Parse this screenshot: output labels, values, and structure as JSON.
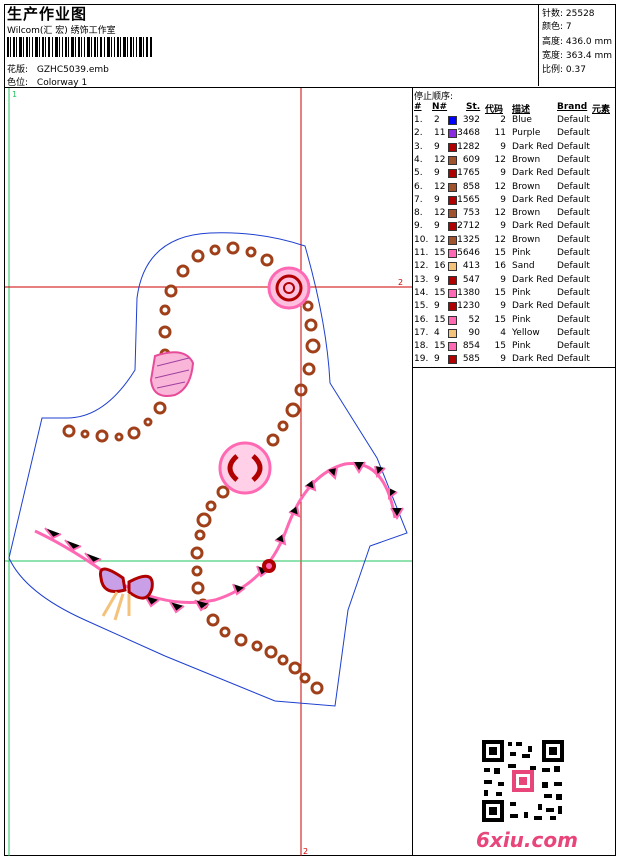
{
  "header": {
    "title": "生产作业图",
    "subtitle": "Wilcom(汇 宏) 绣饰工作室",
    "design_label": "花版:",
    "design_value": "GZHC5039.emb",
    "color_label": "色位:",
    "color_value": "Colorway 1"
  },
  "stats": {
    "stitches": "针数: 25528",
    "colors": "颜色: 7",
    "height": "高度: 436.0 mm",
    "width": "宽度: 363.4 mm",
    "scale": "比例: 0.37"
  },
  "table": {
    "caption": "停止顺序:",
    "headers": {
      "idx": "#",
      "needle": "N#",
      "st": "St.",
      "code": "代码",
      "desc": "描述",
      "brand": "Brand",
      "elem": "元素"
    },
    "rows": [
      {
        "idx": "1.",
        "n": "2",
        "st": "392",
        "code": "2",
        "desc": "Blue",
        "brand": "Default",
        "color": "#0000ff"
      },
      {
        "idx": "2.",
        "n": "11",
        "st": "3468",
        "code": "11",
        "desc": "Purple",
        "brand": "Default",
        "color": "#8a2be2"
      },
      {
        "idx": "3.",
        "n": "9",
        "st": "1282",
        "code": "9",
        "desc": "Dark Red",
        "brand": "Default",
        "color": "#b00000"
      },
      {
        "idx": "4.",
        "n": "12",
        "st": "609",
        "code": "12",
        "desc": "Brown",
        "brand": "Default",
        "color": "#a0522d"
      },
      {
        "idx": "5.",
        "n": "9",
        "st": "1765",
        "code": "9",
        "desc": "Dark Red",
        "brand": "Default",
        "color": "#b00000"
      },
      {
        "idx": "6.",
        "n": "12",
        "st": "858",
        "code": "12",
        "desc": "Brown",
        "brand": "Default",
        "color": "#a0522d"
      },
      {
        "idx": "7.",
        "n": "9",
        "st": "1565",
        "code": "9",
        "desc": "Dark Red",
        "brand": "Default",
        "color": "#b00000"
      },
      {
        "idx": "8.",
        "n": "12",
        "st": "753",
        "code": "12",
        "desc": "Brown",
        "brand": "Default",
        "color": "#a0522d"
      },
      {
        "idx": "9.",
        "n": "9",
        "st": "2712",
        "code": "9",
        "desc": "Dark Red",
        "brand": "Default",
        "color": "#b00000"
      },
      {
        "idx": "10.",
        "n": "12",
        "st": "1325",
        "code": "12",
        "desc": "Brown",
        "brand": "Default",
        "color": "#a0522d"
      },
      {
        "idx": "11.",
        "n": "15",
        "st": "5646",
        "code": "15",
        "desc": "Pink",
        "brand": "Default",
        "color": "#ff69b4"
      },
      {
        "idx": "12.",
        "n": "16",
        "st": "413",
        "code": "16",
        "desc": "Sand",
        "brand": "Default",
        "color": "#f4c27a"
      },
      {
        "idx": "13.",
        "n": "9",
        "st": "547",
        "code": "9",
        "desc": "Dark Red",
        "brand": "Default",
        "color": "#b00000"
      },
      {
        "idx": "14.",
        "n": "15",
        "st": "1380",
        "code": "15",
        "desc": "Pink",
        "brand": "Default",
        "color": "#ff69b4"
      },
      {
        "idx": "15.",
        "n": "9",
        "st": "1230",
        "code": "9",
        "desc": "Dark Red",
        "brand": "Default",
        "color": "#b00000"
      },
      {
        "idx": "16.",
        "n": "15",
        "st": "52",
        "code": "15",
        "desc": "Pink",
        "brand": "Default",
        "color": "#ff69b4"
      },
      {
        "idx": "17.",
        "n": "4",
        "st": "90",
        "code": "4",
        "desc": "Yellow",
        "brand": "Default",
        "color": "#f4c27a"
      },
      {
        "idx": "18.",
        "n": "15",
        "st": "854",
        "code": "15",
        "desc": "Pink",
        "brand": "Default",
        "color": "#ff69b4"
      },
      {
        "idx": "19.",
        "n": "9",
        "st": "585",
        "code": "9",
        "desc": "Dark Red",
        "brand": "Default",
        "color": "#b00000"
      }
    ]
  },
  "design": {
    "guide_labels": [
      "1",
      "2",
      "2"
    ]
  },
  "footer": {
    "logo": "6xiu.com"
  }
}
